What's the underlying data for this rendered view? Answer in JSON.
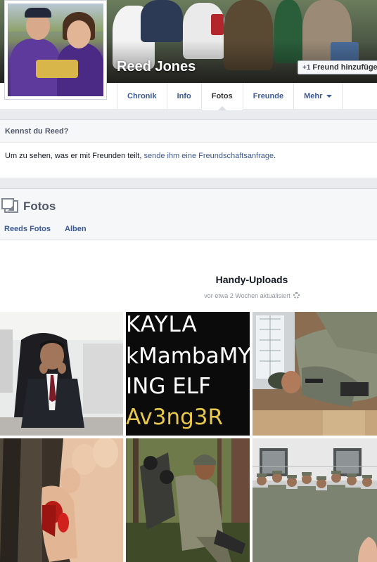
{
  "profile": {
    "name": "Reed Jones",
    "add_friend_label": "Freund hinzufüge",
    "add_friend_icon": "add-friend-icon"
  },
  "tabs": [
    {
      "label": "Chronik"
    },
    {
      "label": "Info"
    },
    {
      "label": "Fotos"
    },
    {
      "label": "Freunde"
    },
    {
      "label": "Mehr"
    }
  ],
  "know": {
    "heading": "Kennst du Reed?",
    "text_before": "Um zu sehen, was er mit Freunden teilt, ",
    "link": "sende ihm eine Freundschaftsanfrage",
    "text_after": "."
  },
  "photos": {
    "heading": "Fotos",
    "icon": "photos-icon",
    "links": [
      "Reeds Fotos",
      "Alben"
    ],
    "album_title": "Handy-Uploads",
    "album_updated": "vor etwa 2 Wochen aktualisiert",
    "photo_text": {
      "line1": "KAYLA",
      "line2": "kMambaMYP",
      "line3": "ING ELF",
      "line4": "Av3ng3R"
    }
  },
  "colors": {
    "link": "#3b5998",
    "panel_bg": "#f6f7f9",
    "page_gap": "#e9ebee",
    "text_yellow": "#e8c84a"
  }
}
